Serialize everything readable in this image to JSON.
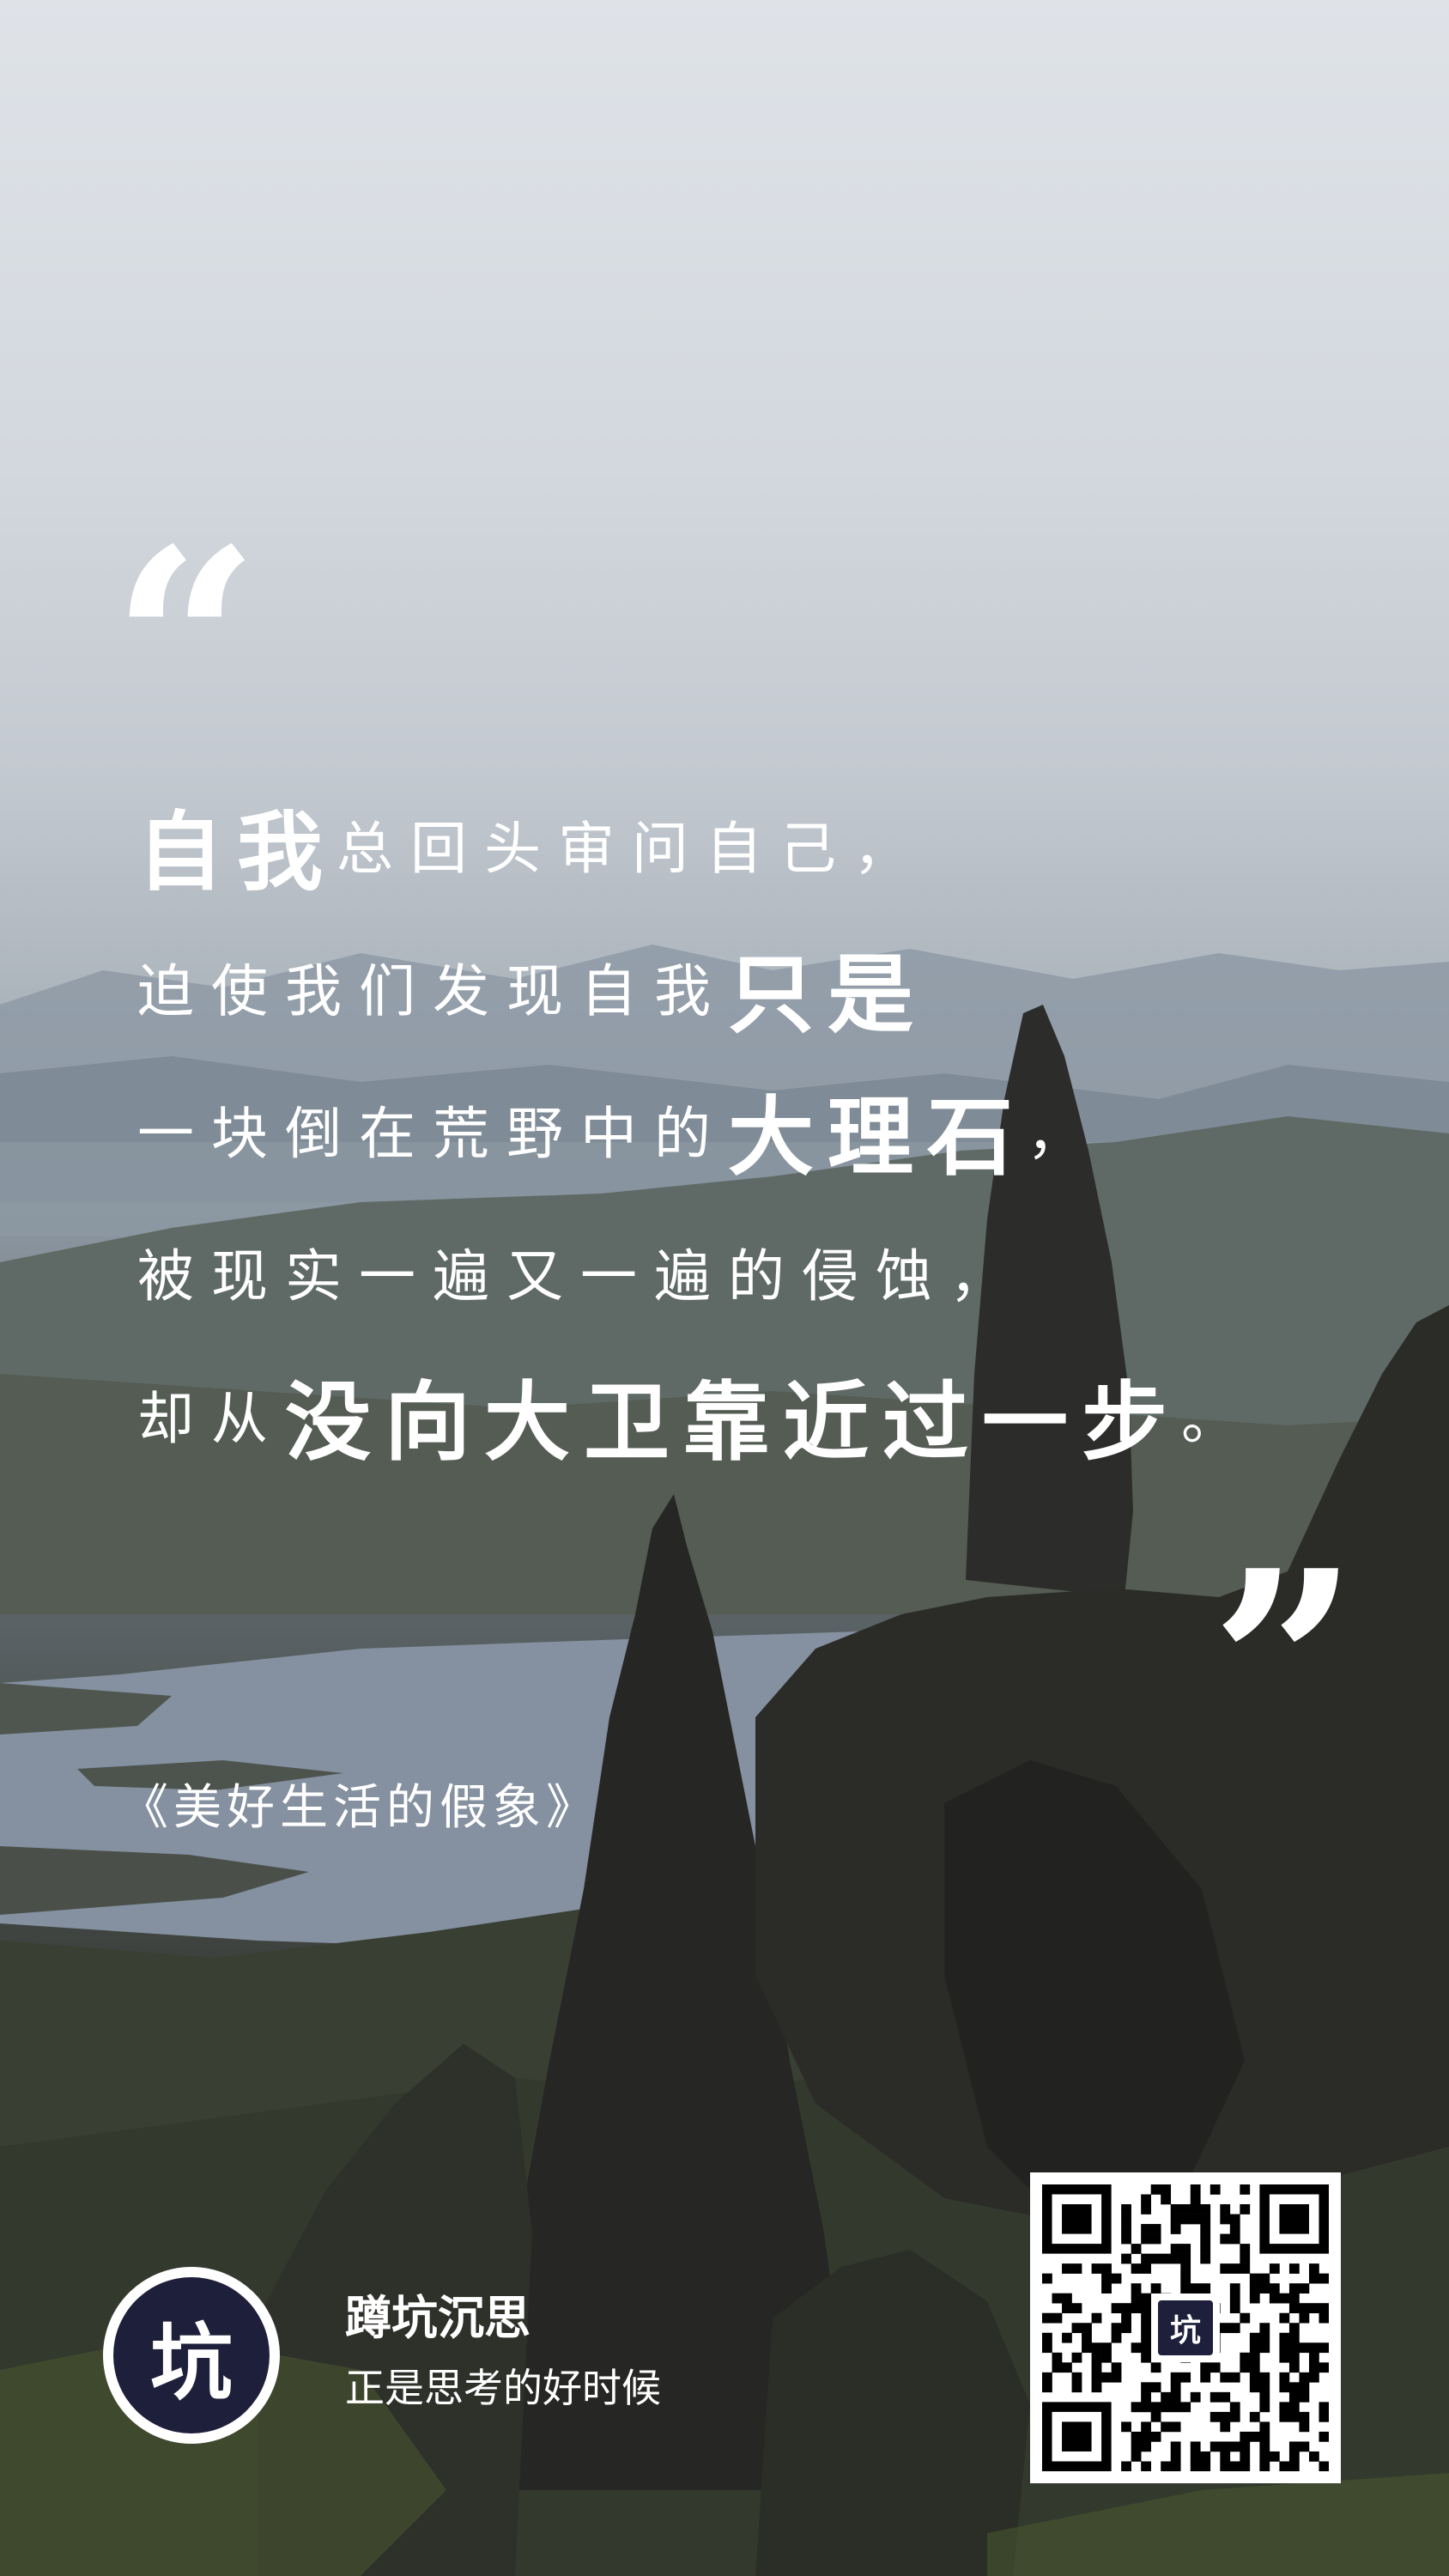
{
  "quote": {
    "open_mark": "“",
    "close_mark": "”",
    "lines": [
      [
        {
          "text": "自我",
          "style": "big"
        },
        {
          "text": "总回头审问自己，",
          "style": "reg"
        }
      ],
      [
        {
          "text": "迫使我们发现自我",
          "style": "reg"
        },
        {
          "text": "只是",
          "style": "big"
        }
      ],
      [
        {
          "text": "一块倒在荒野中的",
          "style": "reg"
        },
        {
          "text": "大理石",
          "style": "big"
        },
        {
          "text": "，",
          "style": "reg"
        }
      ],
      [
        {
          "text": "被现实一遍又一遍的侵蚀，",
          "style": "reg"
        }
      ],
      [
        {
          "text": "却从",
          "style": "reg"
        },
        {
          "text": "没向大卫靠近过一步",
          "style": "big"
        },
        {
          "text": "。",
          "style": "reg"
        }
      ]
    ]
  },
  "source": {
    "book_title": "《美好生活的假象》"
  },
  "footer": {
    "logo_text": "坑",
    "brand_name": "蹲坑沉思",
    "slogan": "正是思考的好时候",
    "qr_center_text": "坑"
  },
  "colors": {
    "text": "#ffffff",
    "logo_bg": "#1e1f3b",
    "sky": "#dfe3e8",
    "rock": "#2a2b28"
  },
  "icons": {
    "logo": "keng-character-logo",
    "qr": "qr-code"
  }
}
